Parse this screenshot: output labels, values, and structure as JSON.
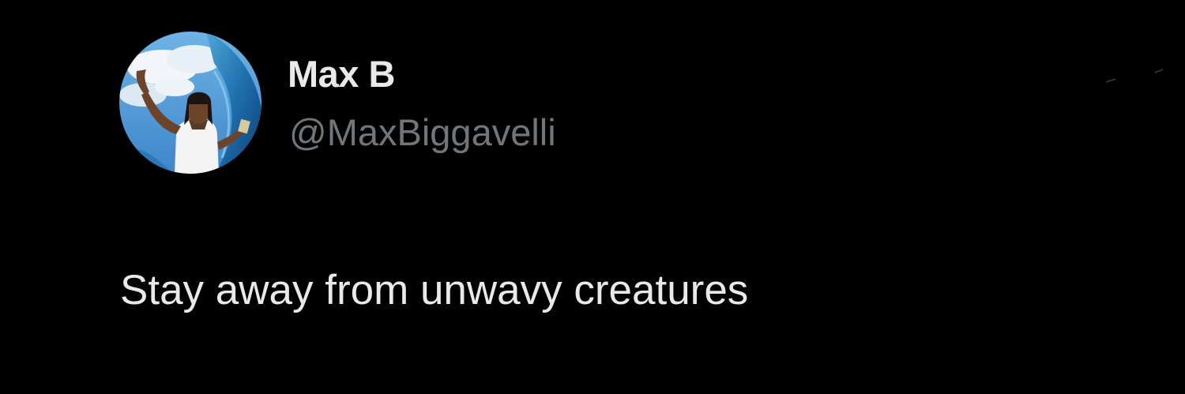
{
  "tweet": {
    "author": {
      "display_name": "Max B",
      "handle": "@MaxBiggavelli",
      "avatar_icon": "profile-photo"
    },
    "text": "Stay away from unwavy creatures"
  },
  "colors": {
    "background": "#000000",
    "primary_text": "#e7e9ea",
    "secondary_text": "#71767b"
  }
}
